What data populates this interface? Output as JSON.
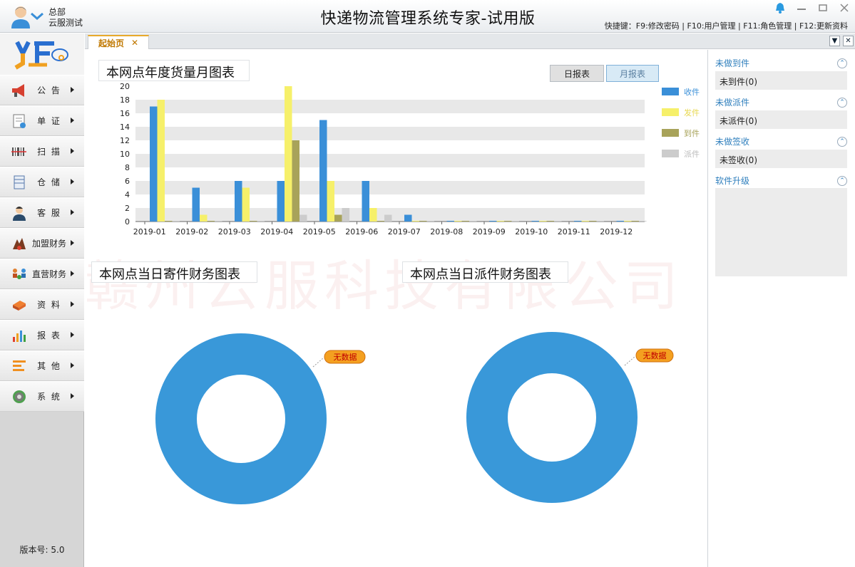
{
  "titlebar": {
    "user_line1": "总部",
    "user_line2": "云服测试",
    "app_title": "快递物流管理系统专家-试用版",
    "shortcuts": "快捷键：F9:修改密码 | F10:用户管理 | F11:角色管理 | F12:更新资料"
  },
  "sidebar": {
    "items": [
      {
        "label": "公 告",
        "icon": "megaphone-icon"
      },
      {
        "label": "单 证",
        "icon": "document-icon"
      },
      {
        "label": "扫 描",
        "icon": "barcode-scanner-icon"
      },
      {
        "label": "仓 储",
        "icon": "warehouse-icon"
      },
      {
        "label": "客 服",
        "icon": "customer-service-icon"
      },
      {
        "label": "加盟财务",
        "icon": "franchise-finance-icon"
      },
      {
        "label": "直营财务",
        "icon": "direct-finance-icon"
      },
      {
        "label": "资 料",
        "icon": "data-icon"
      },
      {
        "label": "报 表",
        "icon": "report-icon"
      },
      {
        "label": "其 他",
        "icon": "other-icon"
      },
      {
        "label": "系 统",
        "icon": "settings-gear-icon"
      }
    ],
    "version": "版本号: 5.0"
  },
  "tabs": [
    {
      "label": "起始页",
      "close": "✕"
    }
  ],
  "tab_controls": {
    "dropdown": "▼",
    "close": "✕"
  },
  "main": {
    "monthly_title": "本网点年度货量月图表",
    "daily_btn": "日报表",
    "monthly_btn": "月报表",
    "send_title": "本网点当日寄件财务图表",
    "dispatch_title": "本网点当日派件财务图表",
    "no_data_1": "无数据",
    "no_data_2": "无数据",
    "watermark": "赣州云服科技有限公司"
  },
  "colors": {
    "received": "#3a8fd8",
    "sent": "#f6f06a",
    "arrived": "#a8a35a",
    "dispatched": "#cccccc",
    "donut": "#3998d9"
  },
  "chart_data": {
    "type": "bar",
    "categories": [
      "2019-01",
      "2019-02",
      "2019-03",
      "2019-04",
      "2019-05",
      "2019-06",
      "2019-07",
      "2019-08",
      "2019-09",
      "2019-10",
      "2019-11",
      "2019-12"
    ],
    "series": [
      {
        "name": "收件",
        "values": [
          17,
          5,
          6,
          6,
          15,
          6,
          1,
          0,
          0,
          0,
          0,
          0
        ]
      },
      {
        "name": "发件",
        "values": [
          18,
          1,
          5,
          20,
          6,
          2,
          0,
          0,
          0,
          0,
          0,
          0
        ]
      },
      {
        "name": "到件",
        "values": [
          0,
          0,
          0,
          12,
          1,
          0,
          0,
          0,
          0,
          0,
          0,
          0
        ]
      },
      {
        "name": "派件",
        "values": [
          0,
          0,
          0,
          1,
          2,
          1,
          0,
          0,
          0,
          0,
          0,
          0
        ]
      }
    ],
    "ylim": [
      0,
      20
    ],
    "yticks": [
      0,
      2,
      4,
      6,
      8,
      10,
      12,
      14,
      16,
      18,
      20
    ],
    "legend": "right",
    "grid": true
  },
  "right_panel": {
    "sections": [
      {
        "title": "未做到件",
        "value": "未到件(0)"
      },
      {
        "title": "未做派件",
        "value": "未派件(0)"
      },
      {
        "title": "未做签收",
        "value": "未签收(0)"
      }
    ],
    "upgrade_title": "软件升级"
  }
}
